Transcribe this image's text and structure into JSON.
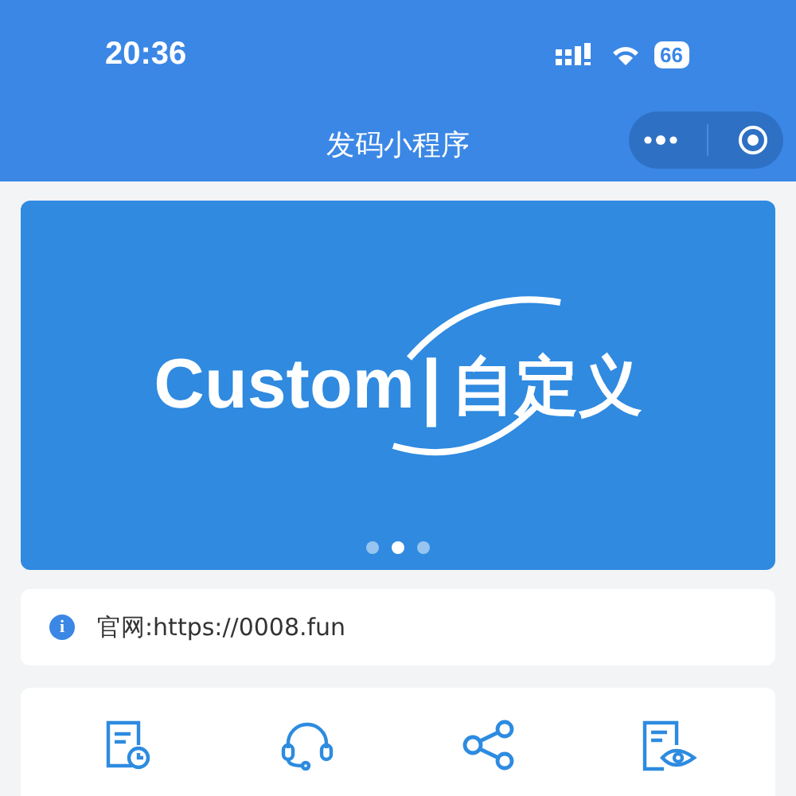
{
  "status_bar": {
    "time": "20:36",
    "battery": "66"
  },
  "nav_bar": {
    "title": "发码小程序"
  },
  "banner": {
    "brand": "Custom",
    "separator": "|",
    "brand_cn": "自定义",
    "dots": [
      {
        "selected": false
      },
      {
        "selected": true
      },
      {
        "selected": false
      }
    ]
  },
  "notice": {
    "icon": "i",
    "text": "官网:https://0008.fun"
  },
  "menu": [
    {
      "kind": "record"
    },
    {
      "kind": "support"
    },
    {
      "kind": "share"
    },
    {
      "kind": "tutorial"
    }
  ]
}
